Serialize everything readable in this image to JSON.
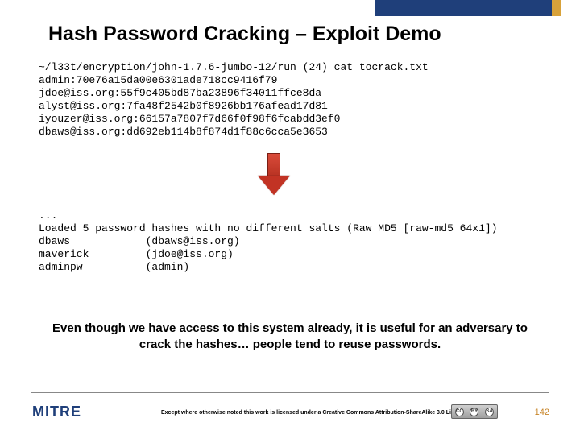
{
  "title": "Hash Password Cracking – Exploit Demo",
  "terminal1": "~/l33t/encryption/john-1.7.6-jumbo-12/run (24) cat tocrack.txt\nadmin:70e76a15da00e6301ade718cc9416f79\njdoe@iss.org:55f9c405bd87ba23896f34011ffce8da\nalyst@iss.org:7fa48f2542b0f8926bb176afead17d81\niyouzer@iss.org:66157a7807f7d66f0f98f6fcabdd3ef0\ndbaws@iss.org:dd692eb114b8f874d1f88c6cca5e3653",
  "terminal2": "...\nLoaded 5 password hashes with no different salts (Raw MD5 [raw-md5 64x1])\ndbaws            (dbaws@iss.org)\nmaverick         (jdoe@iss.org)\nadminpw          (admin)",
  "caption": "Even though we have access to this system already, it is useful for an adversary to crack the hashes… people tend to reuse passwords.",
  "footer": {
    "logo": "MITRE",
    "license": "Except where otherwise noted this work is licensed under a Creative Commons Attribution-ShareAlike 3.0 License",
    "page": "142"
  },
  "arrow": {
    "name": "down-arrow-icon"
  }
}
